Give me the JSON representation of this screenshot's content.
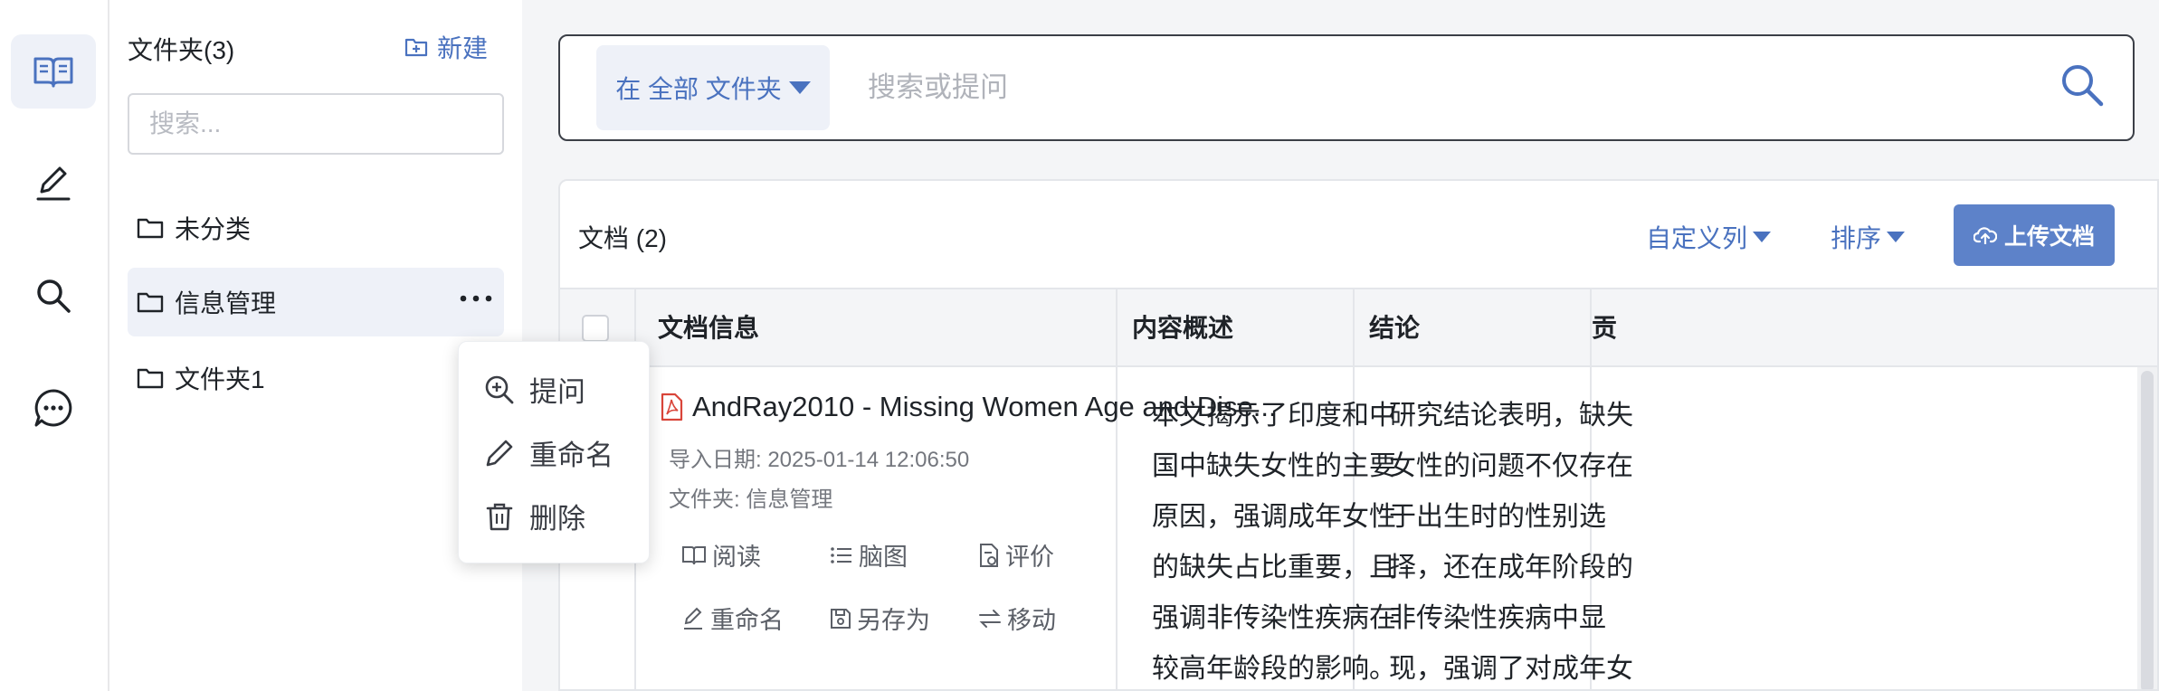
{
  "rail": {
    "items": [
      {
        "icon": "book-icon",
        "active": true
      },
      {
        "icon": "pen-icon",
        "active": false
      },
      {
        "icon": "search-icon",
        "active": false
      },
      {
        "icon": "chat-icon",
        "active": false
      }
    ]
  },
  "folders": {
    "title": "文件夹(3)",
    "new_label": "新建",
    "search_placeholder": "搜索...",
    "items": [
      {
        "label": "未分类",
        "selected": false
      },
      {
        "label": "信息管理",
        "selected": true
      },
      {
        "label": "文件夹1",
        "selected": false
      }
    ]
  },
  "context_menu": {
    "items": [
      {
        "icon": "zoom-in-icon",
        "label": "提问"
      },
      {
        "icon": "pencil-icon",
        "label": "重命名"
      },
      {
        "icon": "trash-icon",
        "label": "删除"
      }
    ]
  },
  "search": {
    "scope_label": "在 全部 文件夹",
    "placeholder": "搜索或提问"
  },
  "documents": {
    "title": "文档 (2)",
    "custom_columns_label": "自定义列",
    "sort_label": "排序",
    "upload_label": "上传文档",
    "columns": [
      "文档信息",
      "内容概述",
      "结论",
      "贡"
    ],
    "rows": [
      {
        "name": "AndRay2010 - Missing Women Age and Dise...",
        "import_date": "导入日期: 2025-01-14 12:06:50",
        "folder": "文件夹: 信息管理",
        "actions_row1": [
          "阅读",
          "脑图",
          "评价"
        ],
        "actions_row2": [
          "重命名",
          "另存为",
          "移动"
        ],
        "summary_lines": [
          "本文揭示了印度和中",
          "国中缺失女性的主要",
          "原因，强调成年女性",
          "的缺失占比重要，且",
          "强调非传染性疾病在",
          "较高年龄段的影响。"
        ],
        "conclusion_lines": [
          "研究结论表明，缺失",
          "女性的问题不仅存在",
          "于出生时的性别选",
          "择，还在成年阶段的",
          "非传染性疾病中显",
          "现，强调了对成年女"
        ]
      }
    ]
  },
  "colors": {
    "accent": "#4a72bf",
    "upload_bg": "#5d82c9",
    "selected_bg": "#eef1f8",
    "pdf_red": "#d9453a"
  }
}
